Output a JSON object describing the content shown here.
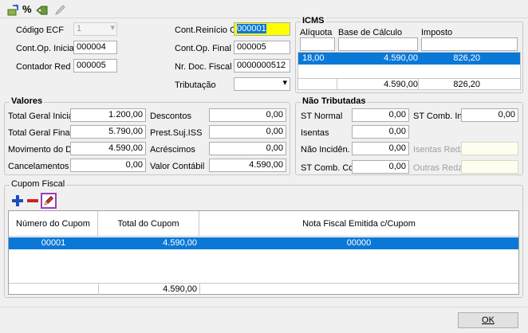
{
  "toolbar": {
    "percent_label": "%"
  },
  "left_fields": {
    "codigo_ecf": {
      "label": "Código ECF",
      "value": "1"
    },
    "cont_op_inicial": {
      "label": "Cont.Op. Inicial",
      "value": "000004"
    },
    "contador_red_z": {
      "label": "Contador Red Z",
      "value": "000005"
    }
  },
  "mid_fields": {
    "cont_reinicio_op": {
      "label": "Cont.Reinício Op.",
      "value": "000001"
    },
    "cont_op_final": {
      "label": "Cont.Op. Final",
      "value": "000005"
    },
    "nr_doc_fiscal": {
      "label": "Nr. Doc. Fiscal",
      "value": "0000000512"
    },
    "tributacao": {
      "label": "Tributação",
      "value": ""
    }
  },
  "icms": {
    "title": "ICMS",
    "columns": [
      "Alíquota",
      "Base de Cálculo",
      "Imposto"
    ],
    "row": {
      "aliquota": "18,00",
      "base": "4.590,00",
      "imposto": "826,20"
    },
    "totals": {
      "base": "4.590,00",
      "imposto": "826,20"
    }
  },
  "valores": {
    "title": "Valores",
    "total_geral_inicial": {
      "label": "Total Geral Inicial",
      "value": "1.200,00"
    },
    "total_geral_final": {
      "label": "Total Geral Final",
      "value": "5.790,00"
    },
    "movimento_do_dia": {
      "label": "Movimento do Dia",
      "value": "4.590,00"
    },
    "cancelamentos": {
      "label": "Cancelamentos",
      "value": "0,00"
    },
    "descontos": {
      "label": "Descontos",
      "value": "0,00"
    },
    "prest_suj_iss": {
      "label": "Prest.Suj.ISS",
      "value": "0,00"
    },
    "acrescimos": {
      "label": "Acréscimos",
      "value": "0,00"
    },
    "valor_contabil": {
      "label": "Valor Contábil",
      "value": "4.590,00"
    }
  },
  "nao_tributadas": {
    "title": "Não Tributadas",
    "st_normal": {
      "label": "ST Normal",
      "value": "0,00"
    },
    "isentas": {
      "label": "Isentas",
      "value": "0,00"
    },
    "nao_incidencia": {
      "label": "Não Incidên.",
      "value": "0,00"
    },
    "st_comb_cons": {
      "label": "ST Comb. Cons",
      "value": "0,00"
    },
    "st_comb_ind": {
      "label": "ST Comb. Ind.",
      "value": "0,00"
    },
    "isentas_redz": {
      "label": "Isentas Redz.",
      "value": ""
    },
    "outras_redz": {
      "label": "Outras Redz.",
      "value": ""
    }
  },
  "cupom": {
    "title": "Cupom Fiscal",
    "columns": [
      "Número do Cupom",
      "Total do Cupom",
      "Nota Fiscal Emitida c/Cupom"
    ],
    "rows": [
      {
        "numero": "00001",
        "total": "4.590,00",
        "nota": "00000"
      }
    ],
    "footer_total": "4.590,00"
  },
  "ok_button": "OK"
}
